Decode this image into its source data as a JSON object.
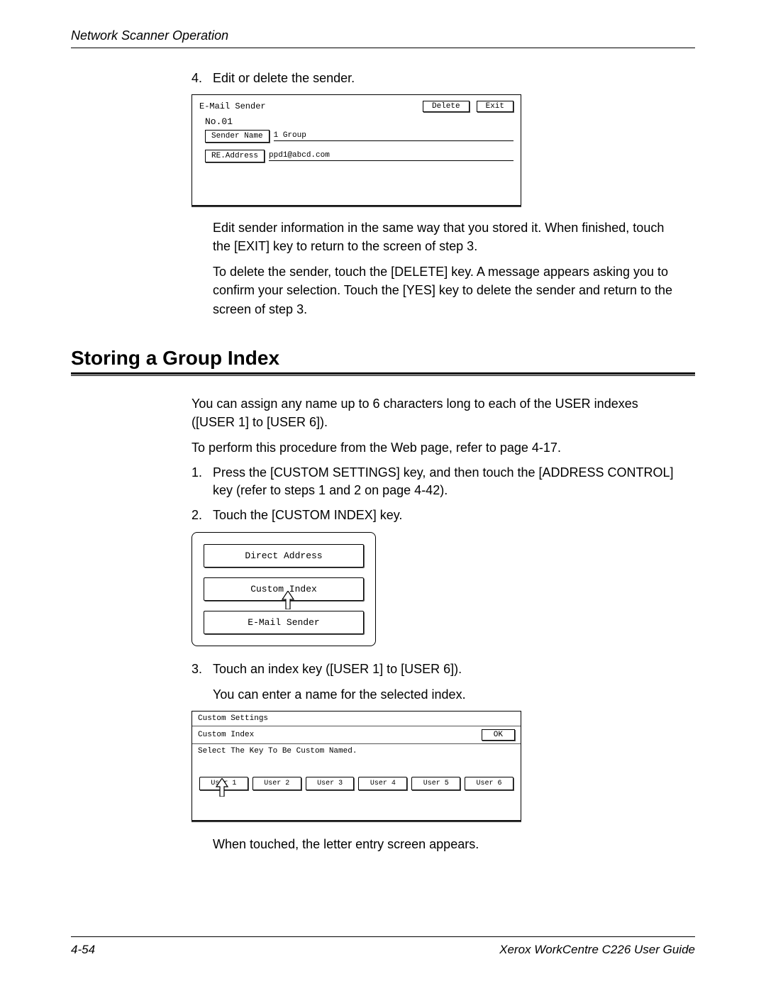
{
  "header": {
    "section": "Network Scanner Operation"
  },
  "step4": {
    "num": "4.",
    "text": "Edit or delete the sender.",
    "para1": "Edit sender information in the same way that you stored it. When finished, touch the [EXIT] key to return to the screen of step 3.",
    "para2": "To delete the sender, touch the [DELETE] key. A message appears asking you to confirm your selection. Touch the [YES] key to delete the sender and return to the screen of step 3."
  },
  "panel1": {
    "title": "E-Mail Sender",
    "delete": "Delete",
    "exit": "Exit",
    "no": "No.01",
    "sender_name_label": "Sender Name",
    "sender_name_value": "1 Group",
    "re_address_label": "RE.Address",
    "re_address_value": "ppd1@abcd.com"
  },
  "heading": "Storing a Group Index",
  "intro": {
    "p1": "You can assign any name up to 6 characters long to each of the USER indexes ([USER 1] to [USER 6]).",
    "p2": "To perform this procedure from the Web page, refer to page 4-17."
  },
  "steps": {
    "s1": {
      "num": "1.",
      "text": "Press the [CUSTOM SETTINGS] key, and then touch the [ADDRESS CONTROL] key (refer to steps 1 and 2 on page 4-42)."
    },
    "s2": {
      "num": "2.",
      "text": "Touch the [CUSTOM INDEX] key."
    },
    "s3": {
      "num": "3.",
      "text": "Touch an index key ([USER 1] to [USER 6])."
    },
    "s3b": "You can enter a name for the selected index.",
    "s3c": "When touched, the letter entry screen appears."
  },
  "panel2": {
    "item1": "Direct Address",
    "item2": "Custom Index",
    "item3": "E-Mail Sender"
  },
  "panel3": {
    "title": "Custom Settings",
    "sub": "Custom Index",
    "ok": "OK",
    "instruction": "Select The Key To Be Custom Named.",
    "tabs": [
      "User 1",
      "User 2",
      "User 3",
      "User 4",
      "User 5",
      "User 6"
    ]
  },
  "footer": {
    "page": "4-54",
    "guide": "Xerox WorkCentre C226 User Guide"
  }
}
